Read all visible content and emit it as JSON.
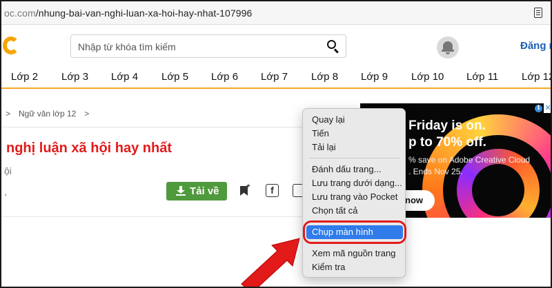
{
  "browser": {
    "url_prefix": "oc.com",
    "url_path": "/nhung-bai-van-nghi-luan-xa-hoi-hay-nhat-107996",
    "reader_icon": "reader-mode-icon"
  },
  "header": {
    "logo_icon": "site-logo",
    "search_placeholder": "Nhập từ khóa tìm kiếm",
    "search_icon": "search-icon",
    "bell_icon": "notification-bell-icon",
    "login_label": "Đăng n"
  },
  "grades": [
    "Lớp 2",
    "Lớp 3",
    "Lớp 4",
    "Lớp 5",
    "Lớp 6",
    "Lớp 7",
    "Lớp 8",
    "Lớp 9",
    "Lớp 10",
    "Lớp 11",
    "Lớp 12"
  ],
  "breadcrumb": {
    "lead_sep": ">",
    "item": "Ngữ văn lớp 12",
    "trail_sep": ">"
  },
  "article": {
    "title": "nghị luận xã hội hay nhất",
    "subtitle": "ội",
    "stray_char": ","
  },
  "actions": {
    "download_label": "Tải về",
    "download_icon": "download-icon",
    "bookmark_icon": "bookmark-add-icon",
    "facebook_icon": "facebook-icon",
    "facebook_glyph": "f",
    "zalo_icon": "zalo-icon"
  },
  "ad": {
    "line1": "Friday is on.",
    "line2": "p to 70% off.",
    "line3": "% save on Adobe Creative Cloud",
    "line4": ". Ends Nov 25.",
    "cta": "now",
    "info_glyph": "i",
    "close_glyph": "✕",
    "accent_colors": [
      "#ff2b6a",
      "#ff7a1a",
      "#ffd33d",
      "#b52cff"
    ]
  },
  "context_menu": {
    "items": [
      "Quay lại",
      "Tiến",
      "Tải lại",
      "Đánh dấu trang...",
      "Lưu trang dưới dạng...",
      "Lưu trang vào Pocket",
      "Chọn tất cả",
      "Chụp màn hình",
      "Xem mã nguồn trang",
      "Kiểm tra"
    ],
    "highlighted": "Chụp màn hình",
    "highlight_color": "#2f7bea",
    "annotation_color": "#e21a1a"
  }
}
